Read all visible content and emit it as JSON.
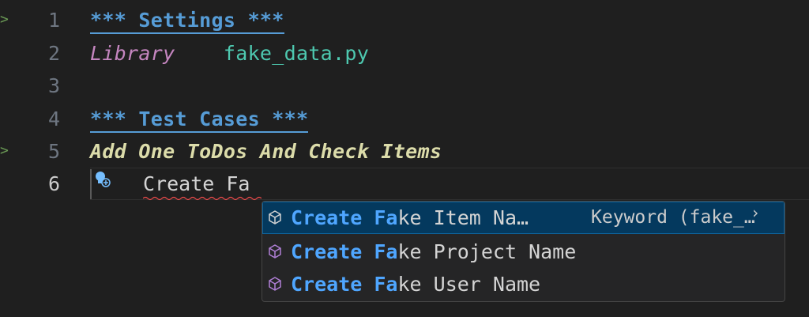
{
  "editor": {
    "lines": [
      {
        "number": "1",
        "segments": {
          "header": "*** Settings ***"
        }
      },
      {
        "number": "2",
        "segments": {
          "keyword": "Library",
          "value": "fake_data.py"
        }
      },
      {
        "number": "3"
      },
      {
        "number": "4",
        "segments": {
          "header": "*** Test Cases ***"
        }
      },
      {
        "number": "5",
        "segments": {
          "testcase": "Add One ToDos And Check Items"
        }
      },
      {
        "number": "6",
        "segments": {
          "typed": "Create Fa"
        }
      }
    ]
  },
  "suggest": {
    "items": [
      {
        "match1": "Create",
        "space": " ",
        "match2": "Fa",
        "rest": "ke Item Na…",
        "detail": "Keyword (fake_…",
        "selected": true
      },
      {
        "match1": "Create",
        "space": " ",
        "match2": "Fa",
        "rest": "ke Project Name",
        "selected": false
      },
      {
        "match1": "Create",
        "space": " ",
        "match2": "Fa",
        "rest": "ke User Name",
        "selected": false
      }
    ]
  },
  "icons": {
    "fold": "chevron-right-icon",
    "lightbulb": "lightbulb-icon",
    "keyword": "cube-icon",
    "details": "chevron-right-icon"
  },
  "colors": {
    "background": "#1f1f1f",
    "header": "#569cd6",
    "keyword": "#c586c0",
    "library": "#4ec9b0",
    "testcase": "#dcdcaa",
    "match": "#4fa6ff",
    "selected": "#04395e"
  }
}
